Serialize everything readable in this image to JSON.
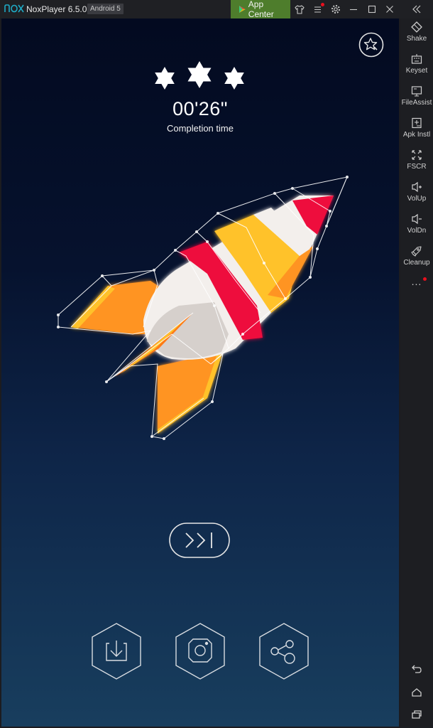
{
  "titlebar": {
    "logo": "nox-logo",
    "app_name": "NoxPlayer 6.5.0.0",
    "android_version": "Android 5",
    "app_center_label": "App Center",
    "icons": [
      "theme-shirt-icon",
      "menu-icon",
      "settings-gear-icon",
      "minimize-icon",
      "maximize-icon",
      "close-icon",
      "collapse-sidebar-icon"
    ],
    "menu_has_notification": true
  },
  "sidebar": {
    "items": [
      {
        "label": "Shake",
        "icon": "shake-icon"
      },
      {
        "label": "Keyset",
        "icon": "keyboard-icon"
      },
      {
        "label": "FileAssist",
        "icon": "monitor-icon"
      },
      {
        "label": "Apk Instl",
        "icon": "apk-install-icon"
      },
      {
        "label": "FSCR",
        "icon": "fullscreen-icon"
      },
      {
        "label": "VolUp",
        "icon": "volume-up-icon"
      },
      {
        "label": "VolDn",
        "icon": "volume-down-icon"
      },
      {
        "label": "Cleanup",
        "icon": "rocket-icon"
      }
    ],
    "more_label": "...",
    "more_has_notification": true,
    "nav": [
      "back-icon",
      "home-icon",
      "recent-apps-icon"
    ]
  },
  "game": {
    "stars_earned": 3,
    "stars_total": 3,
    "completion_time": "00'26\"",
    "completion_label": "Completion time",
    "actions": [
      "save-download",
      "instagram-share",
      "share"
    ],
    "skip_icon": "skip-next-icon",
    "achievement_icon": "star-badge-icon"
  },
  "colors": {
    "app_center_green": "#4e7d2c",
    "notification_red": "#e8101e",
    "rocket_orange": "#ff9420",
    "rocket_yellow": "#ffc22a",
    "rocket_red": "#ee0a3c",
    "rocket_white": "#f3efec"
  }
}
